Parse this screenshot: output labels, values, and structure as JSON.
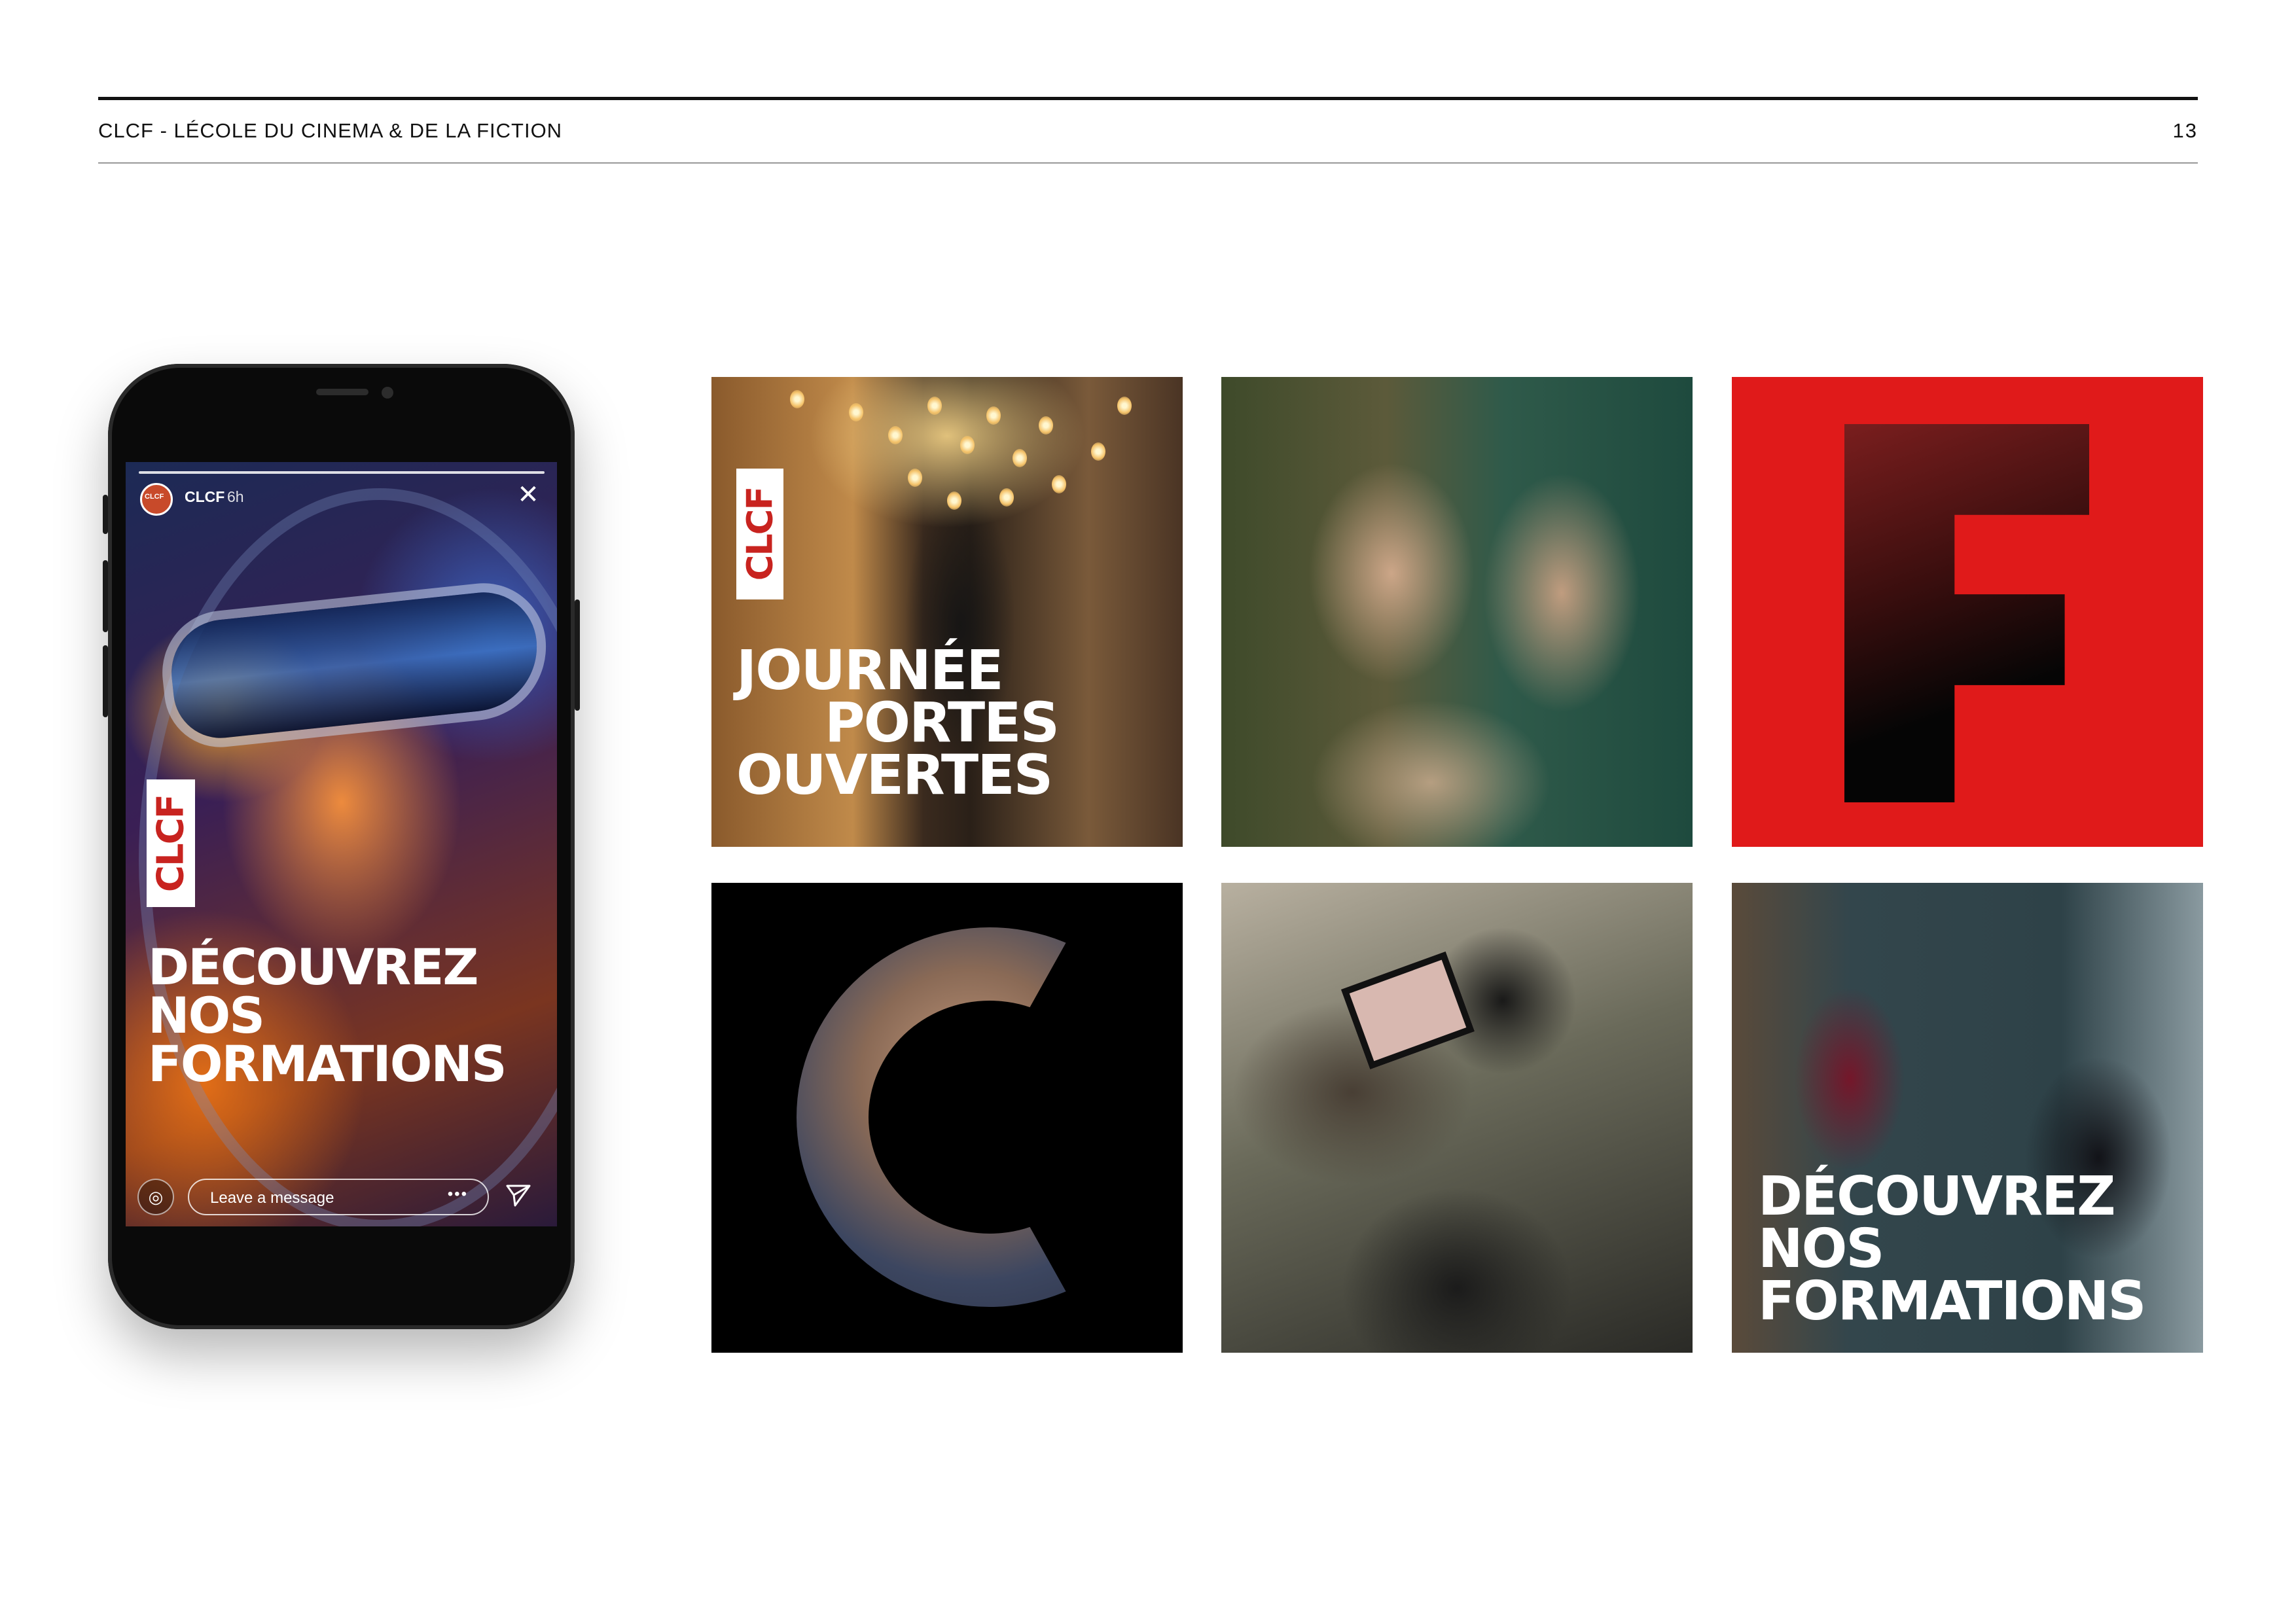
{
  "header": {
    "title": "CLCF - LÉCOLE DU CINEMA & DE LA FICTION",
    "page_number": "13"
  },
  "phone_story": {
    "account": "CLCF",
    "avatar_text": "CLCF",
    "time": "6h",
    "logo_text": "CLCF",
    "headline": [
      "DÉCOUVREZ",
      "NOS",
      "FORMATIONS"
    ],
    "message_placeholder": "Leave a message",
    "more_glyph": "•••"
  },
  "tiles": {
    "open_days": {
      "logo_text": "CLCF",
      "lines": [
        "JOURNÉE",
        "PORTES",
        "OUVERTES"
      ]
    },
    "formations": {
      "lines": [
        "DÉCOUVREZ",
        "NOS",
        "FORMATIONS"
      ]
    }
  },
  "colors": {
    "brand_red": "#e01a1a",
    "logo_red": "#c8231f"
  }
}
